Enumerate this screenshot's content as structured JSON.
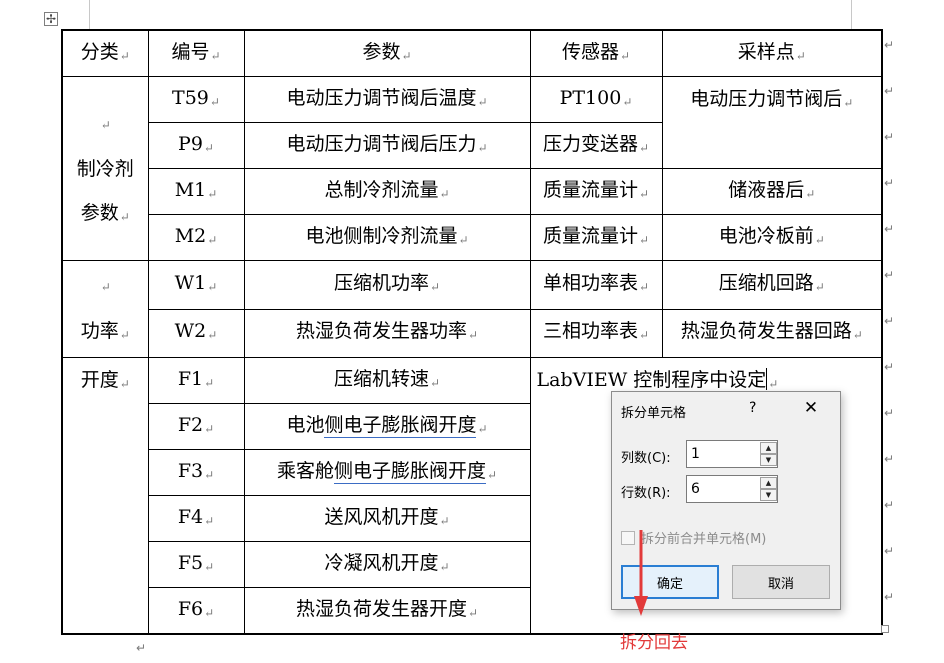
{
  "table": {
    "headers": [
      "分类",
      "编号",
      "参数",
      "传感器",
      "采样点"
    ],
    "categories": {
      "refrigerant_line1": "制冷剂",
      "refrigerant_line2": "参数",
      "power": "功率",
      "opening": "开度"
    },
    "rows": [
      {
        "id": "T59",
        "param": "电动压力调节阀后温度",
        "sensor": "PT100",
        "point": "电动压力调节阀后"
      },
      {
        "id": "P9",
        "param": "电动压力调节阀后压力",
        "sensor": "压力变送器",
        "point": ""
      },
      {
        "id": "M1",
        "param": "总制冷剂流量",
        "sensor": "质量流量计",
        "point": "储液器后"
      },
      {
        "id": "M2",
        "param": "电池侧制冷剂流量",
        "sensor": "质量流量计",
        "point": "电池冷板前"
      },
      {
        "id": "W1",
        "param": "压缩机功率",
        "sensor": "单相功率表",
        "point": "压缩机回路"
      },
      {
        "id": "W2",
        "param": "热湿负荷发生器功率",
        "sensor": "三相功率表",
        "point": "热湿负荷发生器回路"
      },
      {
        "id": "F1",
        "param": "压缩机转速"
      },
      {
        "id": "F2",
        "param_plain": "电池",
        "param_underlined": "侧电子膨胀阀开度"
      },
      {
        "id": "F3",
        "param_plain": "乘客舱",
        "param_underlined": "侧电子膨胀阀开度"
      },
      {
        "id": "F4",
        "param": "送风风机开度"
      },
      {
        "id": "F5",
        "param": "冷凝风机开度"
      },
      {
        "id": "F6",
        "param": "热湿负荷发生器开度"
      }
    ],
    "merged_note": "LabVIEW 控制程序中设定",
    "paragraph_mark": "↵",
    "move_handle_icon": "✢"
  },
  "dialog": {
    "title": "拆分单元格",
    "help": "?",
    "close": "✕",
    "columns_label": "列数(C):",
    "columns_value": "1",
    "rows_label": "行数(R):",
    "rows_value": "6",
    "merge_checkbox_label": "拆分前合并单元格(M)",
    "ok": "确定",
    "cancel": "取消"
  },
  "annotation": {
    "text": "拆分回去",
    "color": "#e23a3a"
  },
  "colors": {
    "underline": "#3b6cc4",
    "dialog_focus": "#2a7ed3"
  }
}
